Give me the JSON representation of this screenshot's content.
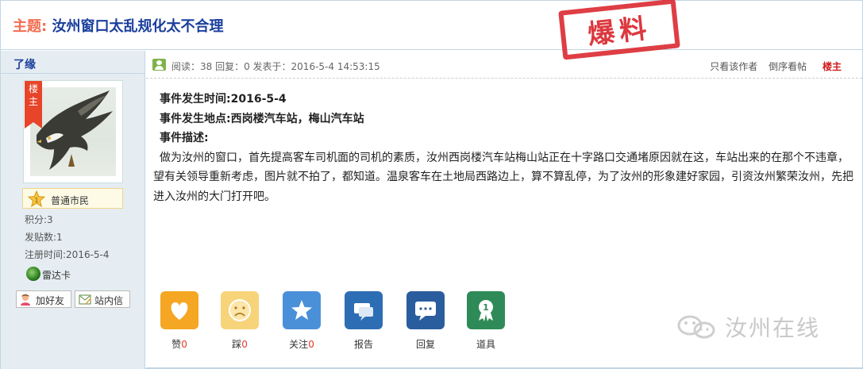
{
  "thread": {
    "title_prefix": "主题:",
    "title": "汝州窗口太乱规化太不合理",
    "stamp": "爆料"
  },
  "author": {
    "name": "了缘",
    "host_badge": "楼主",
    "rank": "普通市民",
    "rank_level": "1",
    "points": "积分:3",
    "posts": "发贴数:1",
    "register": "注册时间:2016-5-4",
    "card": "雷达卡",
    "add_friend": "加好友",
    "message": "站内信"
  },
  "meta": {
    "stats": "阅读：38   回复：0   发表于：2016-5-4 14:53:15",
    "only_author": "只看该作者",
    "reverse": "倒序看帖",
    "floor": "楼主"
  },
  "content": {
    "time": "事件发生时间:2016-5-4",
    "place": "事件发生地点:西岗楼汽车站，梅山汽车站",
    "desc_label": "事件描述:",
    "desc": "做为汝州的窗口，首先提高客车司机面的司机的素质，汝州西岗楼汽车站梅山站正在十字路口交通堵原因就在这，车站出来的在那个不违章，望有关领导重新考虑，图片就不拍了，都知道。温泉客车在土地局西路边上，算不算乱停，为了汝州的形象建好家园，引资汝州繁荣汝州，先把进入汝州的大门打开吧。"
  },
  "actions": {
    "like": {
      "label": "赞",
      "count": "0"
    },
    "dislike": {
      "label": "踩",
      "count": "0"
    },
    "follow": {
      "label": "关注",
      "count": "0"
    },
    "report": {
      "label": "报告"
    },
    "reply": {
      "label": "回复"
    },
    "tools": {
      "label": "道具"
    }
  },
  "watermark": "汝州在线",
  "colors": {
    "title_prefix": "#f26c4f",
    "title": "#1a3e9c",
    "stamp": "#d9232a",
    "like": "#f5a623",
    "dislike": "#f7d37a",
    "follow": "#4a90d9",
    "report": "#2d6db3",
    "reply": "#2a5d9e",
    "tools": "#2e8b57"
  }
}
